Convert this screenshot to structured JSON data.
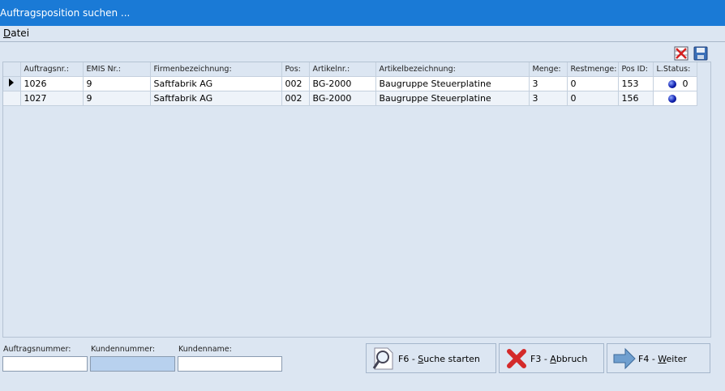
{
  "window": {
    "title": "Auftragsposition suchen ..."
  },
  "menu": {
    "datei_underlined": "D",
    "datei_rest": "atei"
  },
  "toolbar": {
    "delete_icon": "delete-grid-icon",
    "save_icon": "floppy-disk-icon"
  },
  "table": {
    "headers": [
      "Auftragsnr.:",
      "EMIS Nr.:",
      "Firmenbezeichnung:",
      "Pos:",
      "Artikelnr.:",
      "Artikelbezeichnung:",
      "Menge:",
      "Restmenge:",
      "Pos ID:",
      "L.Status:"
    ],
    "rows": [
      {
        "auftragsnr": "1026",
        "emis": "9",
        "firma": "Saftfabrik AG",
        "pos": "002",
        "artikelnr": "BG-2000",
        "artikelbez": "Baugruppe Steuerplatine",
        "menge": "3",
        "restmenge": "0",
        "posid": "153",
        "status": "0",
        "current": true
      },
      {
        "auftragsnr": "1027",
        "emis": "9",
        "firma": "Saftfabrik AG",
        "pos": "002",
        "artikelnr": "BG-2000",
        "artikelbez": "Baugruppe Steuerplatine",
        "menge": "3",
        "restmenge": "0",
        "posid": "156",
        "status": "",
        "current": false
      }
    ],
    "status_color": "#1020b0"
  },
  "filters": {
    "auftragsnummer_label": "Auftragsnummer:",
    "kundennummer_label": "Kundennummer:",
    "kundenname_label": "Kundenname:",
    "auftragsnummer_value": "",
    "kundennummer_value": "",
    "kundenname_value": ""
  },
  "buttons": {
    "search": {
      "pre": "F6 - ",
      "u": "S",
      "post": "uche starten",
      "icon": "magnifier-icon"
    },
    "cancel": {
      "pre": "F3 - ",
      "u": "A",
      "post": "bbruch",
      "icon": "red-x-icon"
    },
    "next": {
      "pre": "F4 - ",
      "u": "W",
      "post": "eiter",
      "icon": "right-arrow-icon"
    }
  },
  "colors": {
    "titlebar": "#1a7ad6",
    "background": "#dce6f2",
    "accent_input": "#b8d1ee"
  }
}
